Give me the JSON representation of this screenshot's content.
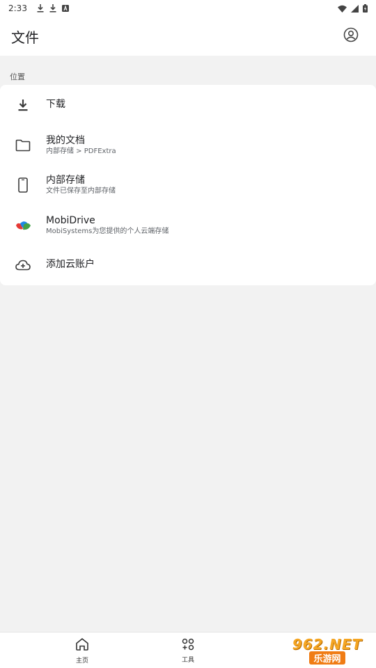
{
  "status_bar": {
    "time": "2:33",
    "left_icons": [
      "download-icon",
      "download-icon",
      "a-badge-icon"
    ],
    "right_icons": [
      "wifi-icon",
      "signal-icon",
      "battery-icon"
    ]
  },
  "app_bar": {
    "title": "文件",
    "account_icon": "account-circle-icon"
  },
  "section": {
    "label": "位置"
  },
  "locations": [
    {
      "title": "下载",
      "subtitle": "",
      "icon": "download-icon"
    },
    {
      "title": "我的文档",
      "subtitle": "内部存储 > PDFExtra",
      "icon": "folder-icon"
    },
    {
      "title": "内部存储",
      "subtitle": "文件已保存至内部存储",
      "icon": "phone-icon"
    },
    {
      "title": "MobiDrive",
      "subtitle": "MobiSystems为您提供的个人云端存储",
      "icon": "mobidrive-icon"
    },
    {
      "title": "添加云账户",
      "subtitle": "",
      "icon": "cloud-add-icon"
    }
  ],
  "bottom_nav": {
    "home_label": "主页",
    "tools_label": "工具"
  },
  "watermark": {
    "top": "962.NET",
    "bottom": "乐游网"
  },
  "colors": {
    "background": "#f2f2f2",
    "surface": "#ffffff",
    "text": "#202124",
    "mobidrive_blue": "#1e88e5",
    "mobidrive_green": "#43a047",
    "mobidrive_red": "#e53935"
  }
}
